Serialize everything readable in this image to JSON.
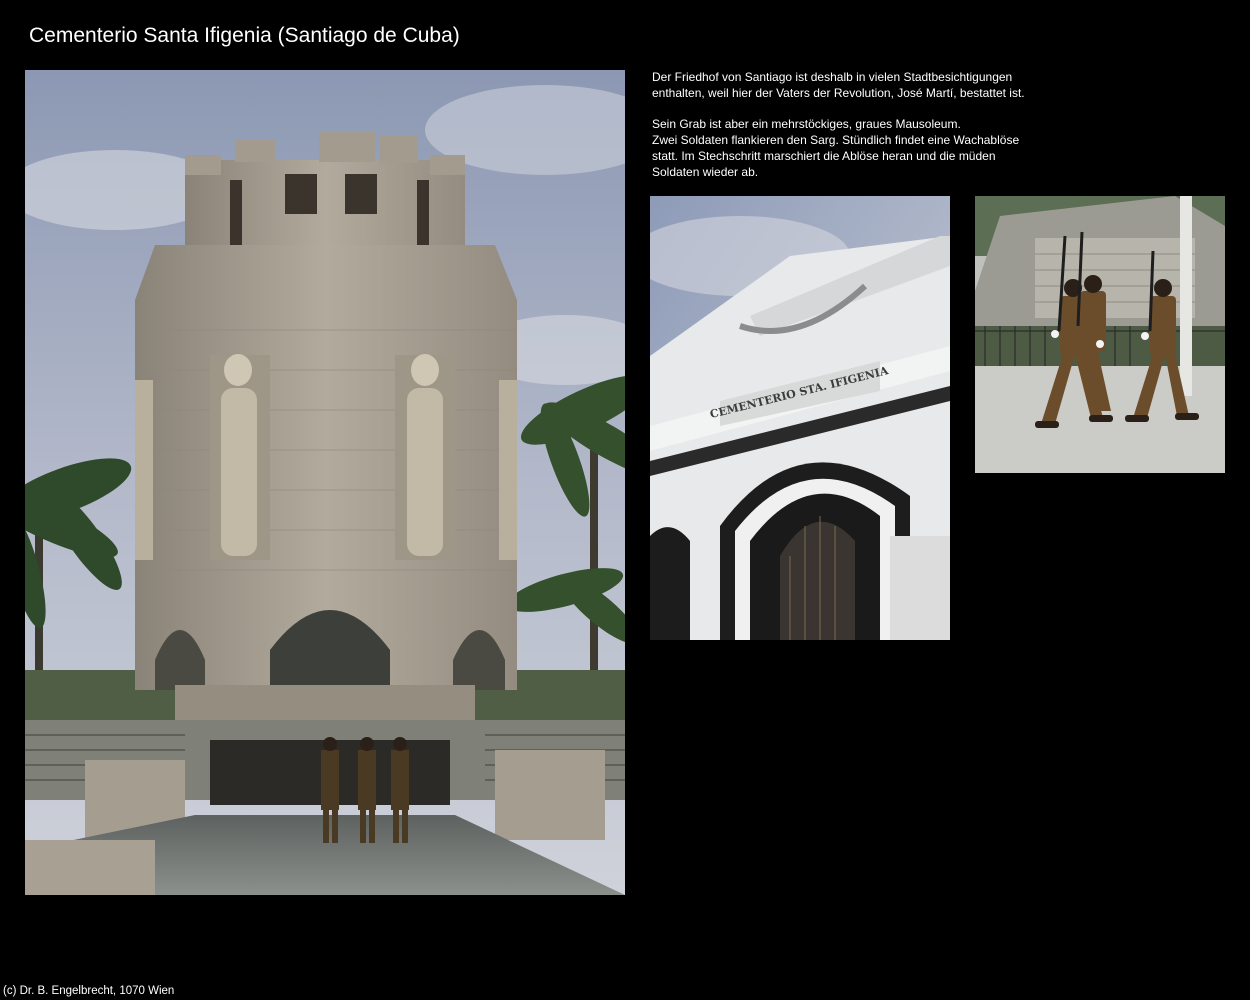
{
  "page": {
    "title": "Cementerio Santa Ifigenia (Santiago de Cuba)",
    "description": [
      "Der Friedhof von Santiago ist deshalb in vielen Stadtbesichtigungen\nenthalten, weil hier der Vaters der Revolution, José Martí, bestattet ist.",
      "Sein Grab ist aber ein mehrstöckiges, graues Mausoleum.\nZwei Soldaten flankieren den Sarg. Stündlich findet eine Wachablöse\nstatt. Im Stechschritt marschiert die Ablöse heran und die müden\nSoldaten wieder ab."
    ],
    "footer": "(c) Dr. B. Engelbrecht, 1070 Wien"
  },
  "photos": {
    "entrance_sign": "CEMENTERIO STA. IFIGENIA"
  },
  "colors": {
    "background": "#000000",
    "text": "#ffffff"
  }
}
